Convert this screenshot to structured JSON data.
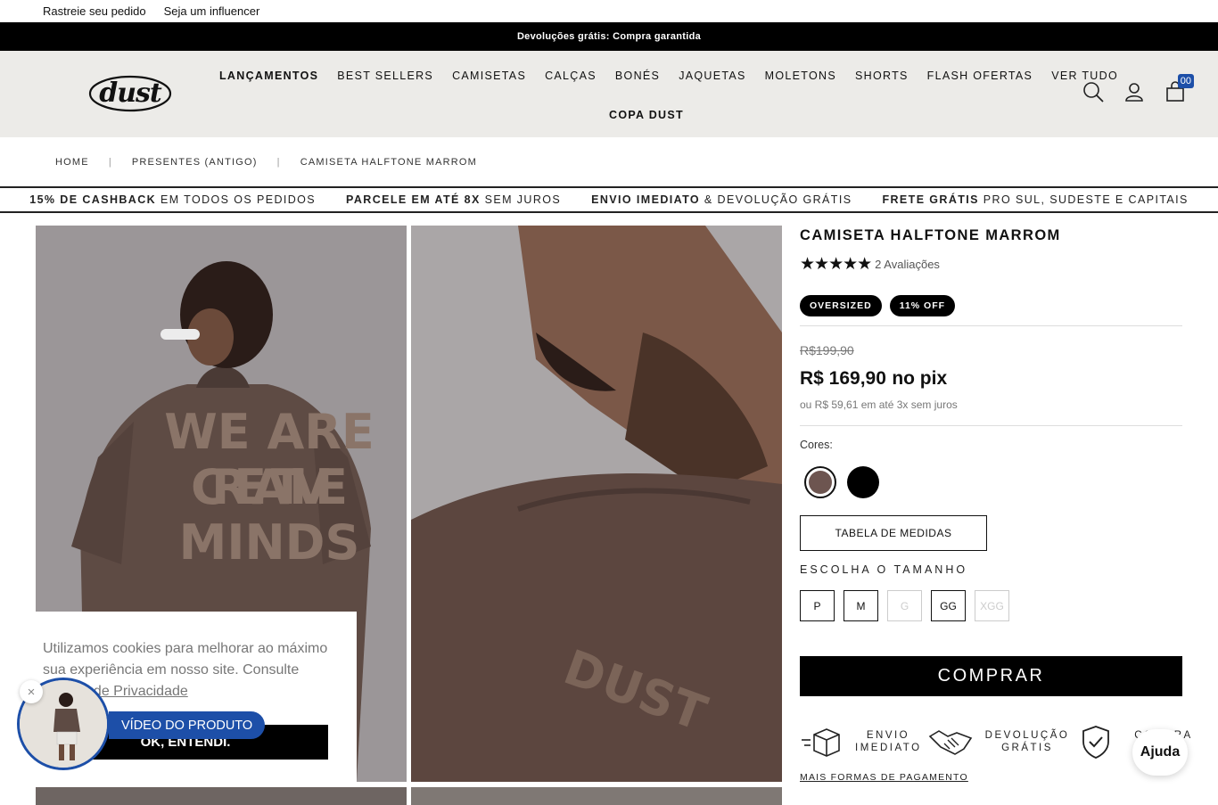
{
  "topbar": {
    "track": "Rastreie seu pedido",
    "influencer": "Seja um influencer"
  },
  "announcement": "Devoluções grátis: Compra garantida",
  "header": {
    "logo": "dust",
    "nav": [
      "LANÇAMENTOS",
      "BEST SELLERS",
      "CAMISETAS",
      "CALÇAS",
      "BONÉS",
      "JAQUETAS",
      "MOLETONS",
      "SHORTS",
      "FLASH OFERTAS",
      "VER TUDO"
    ],
    "nav_row2": "COPA DUST",
    "cart_count": "00",
    "icons": [
      "search-icon",
      "user-icon",
      "bag-icon"
    ]
  },
  "breadcrumb": [
    "HOME",
    "PRESENTES (ANTIGO)",
    "CAMISETA HALFTONE MARROM"
  ],
  "benefits": [
    {
      "bold": "15% DE CASHBACK",
      "rest": " EM TODOS OS PEDIDOS"
    },
    {
      "bold": "PARCELE EM ATÉ 8X",
      "rest": " SEM JUROS"
    },
    {
      "bold": "ENVIO IMEDIATO",
      "rest": " & DEVOLUÇÃO GRÁTIS"
    },
    {
      "bold": "FRETE GRÁTIS",
      "rest": " PRO SUL, SUDESTE E CAPITAIS"
    }
  ],
  "product": {
    "title": "CAMISETA HALFTONE MARROM",
    "stars": "★★★★★",
    "reviews": "2 Avaliações",
    "tags": [
      "OVERSIZED",
      "11% OFF"
    ],
    "old_price": "R$199,90",
    "price": "R$ 169,90",
    "price_suffix": "no pix",
    "installments": "ou R$ 59,61 em até 3x sem juros",
    "colors_label": "Cores:",
    "colors": [
      "#6d5550",
      "#000000"
    ],
    "size_chart": "TABELA DE MEDIDAS",
    "choose_size": "ESCOLHA O TAMANHO",
    "sizes": [
      {
        "label": "P",
        "available": true
      },
      {
        "label": "M",
        "available": true
      },
      {
        "label": "G",
        "available": false
      },
      {
        "label": "GG",
        "available": true
      },
      {
        "label": "XGG",
        "available": false
      }
    ],
    "buy": "COMPRAR",
    "perks": [
      "ENVIO IMEDIATO",
      "DEVOLUÇÃO GRÁTIS",
      "COMPRA SE..."
    ],
    "perk_lines": [
      [
        "ENVIO",
        "IMEDIATO"
      ],
      [
        "DEVOLUÇÃO",
        "GRÁTIS"
      ],
      [
        "COMPRA",
        "SE"
      ]
    ],
    "payments_link": "MAIS FORMAS DE PAGAMENTO"
  },
  "photos": {
    "back_print": [
      "WE ARE",
      "CREATIVE",
      "MINDS"
    ],
    "chest_print": "DUST"
  },
  "cookie": {
    "text": "Utilizamos cookies para melhorar ao máximo sua experiência em nosso site. Consulte",
    "link": "Política de Privacidade",
    "button": "OK, ENTENDI."
  },
  "video": {
    "label": "VÍDEO DO PRODUTO",
    "close": "×"
  },
  "help": "Ajuda"
}
